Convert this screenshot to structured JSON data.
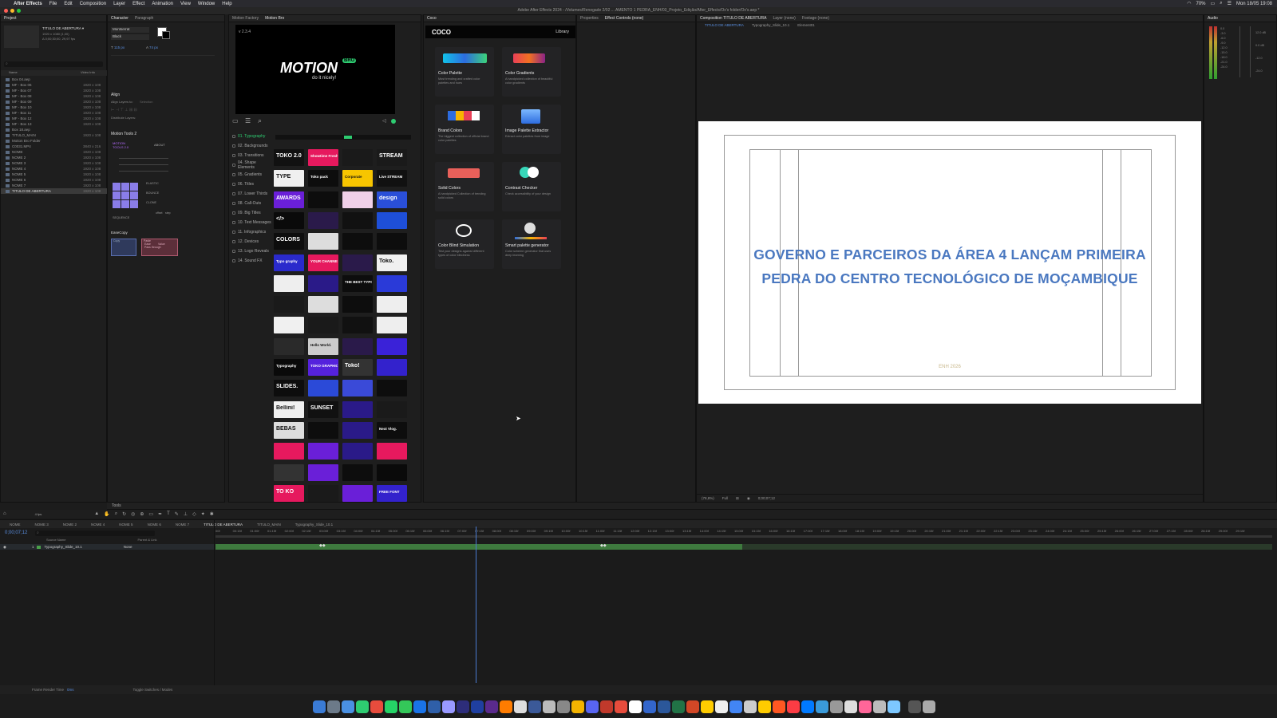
{
  "menubar": {
    "apple": "",
    "app": "After Effects",
    "items": [
      "File",
      "Edit",
      "Composition",
      "Layer",
      "Effect",
      "Animation",
      "View",
      "Window",
      "Help"
    ],
    "battery": "70%",
    "clock": "Mon 18/05  19:08"
  },
  "window_title": "Adobe After Effects 2024 - /Volumes/Renegade 2/02 ... AMENTO 1 PEDRA_ENH/03_Projeto_Edição/After_Effects/Ox's folder/Ox's.aep *",
  "project": {
    "tab": "Project",
    "comp_name": "TITULO DE ABERTURA ▾",
    "comp_info": [
      "1920 x 1080 (1,00)",
      "Δ 0;00;30;00, 29,97 fps"
    ],
    "col_name": "Name",
    "col_video": "Video Info",
    "items": [
      {
        "name": "Box 04.aep",
        "info": ""
      },
      {
        "name": "MF - Box 06",
        "info": "1920 x 108"
      },
      {
        "name": "MF - Box 07",
        "info": "1920 x 108"
      },
      {
        "name": "MF - Box 08",
        "info": "1920 x 108"
      },
      {
        "name": "MF - Box 09",
        "info": "1920 x 108"
      },
      {
        "name": "MF - Box 10",
        "info": "1920 x 108"
      },
      {
        "name": "MF - Box 11",
        "info": "1920 x 108"
      },
      {
        "name": "MF - Box 12",
        "info": "1920 x 108"
      },
      {
        "name": "MF - Box 13",
        "info": "1920 x 108"
      },
      {
        "name": "Box 18.aep",
        "info": ""
      },
      {
        "name": "TITULO_MAIN",
        "info": "1920 x 108"
      },
      {
        "name": "Motion Bro Folder",
        "info": ""
      },
      {
        "name": "C0031.MP4",
        "info": "3840 x 216"
      },
      {
        "name": "NOME",
        "info": "1920 x 108"
      },
      {
        "name": "NOME 2",
        "info": "1920 x 108"
      },
      {
        "name": "NOME 3",
        "info": "1920 x 108"
      },
      {
        "name": "NOME 4",
        "info": "1920 x 108"
      },
      {
        "name": "NOME 5",
        "info": "1920 x 108"
      },
      {
        "name": "NOME 6",
        "info": "1920 x 108"
      },
      {
        "name": "NOME 7",
        "info": "1920 x 108"
      },
      {
        "name": "TITULO DE ABERTURA",
        "info": "1920 x 108"
      }
    ]
  },
  "character": {
    "tabs": [
      "Character",
      "Paragraph"
    ],
    "font": "Montserrat",
    "style": "Black",
    "size": "115 px",
    "leading": "74 px",
    "align_title": "Align",
    "align_to": "Align Layers to:",
    "align_sel": "Selection",
    "distribute": "Distribute Layers:"
  },
  "motion_tools": {
    "title": "Motion Tools 2",
    "logo": "MOTION TOOLS 2.0",
    "about": "ABOUT",
    "labels": [
      "ELASTIC",
      "BOUNCE",
      "CLONE",
      "SEQUENCE",
      "offset",
      "step"
    ]
  },
  "easecopy": {
    "title": "EaseCopy",
    "copy": "Copy",
    "paste": "Paste",
    "ease": "Ease",
    "value": "Value",
    "pass": "Pass through"
  },
  "motion_bro": {
    "tabs": [
      "Motion Factory",
      "Motion Bro"
    ],
    "version": "v 2.3.4",
    "logo": "MOTION",
    "logo_badge": "BRO",
    "tagline": "do it nicely!",
    "categories": [
      "01. Typography",
      "02. Backgrounds",
      "03. Transitions",
      "04. Shape Elements",
      "05. Gradients",
      "06. Titles",
      "07. Lower Thirds",
      "08. Call-Outs",
      "09. Big Titles",
      "10. Text Messages",
      "11. Infographics",
      "12. Devices",
      "13. Logo Reveals",
      "14. Sound FX"
    ],
    "thumbs_text": [
      "TOKO 2.0",
      "Showtime Fresh",
      "",
      "STREAM",
      "TYPE",
      "Toko pack",
      "Corporate",
      "Live STREAM",
      "AWARDS",
      "",
      "",
      "design",
      "</>",
      "",
      "",
      "",
      "COLORS",
      "",
      "",
      "",
      "Typo graphy",
      "YOUR CHANNEL",
      "",
      "Toko.",
      "",
      "",
      "THE BEST TYPOGRAPHY",
      "",
      "",
      "",
      "",
      "",
      "",
      "",
      "",
      "",
      "",
      "Hello World.",
      "",
      "",
      "Typography",
      "TOKO GRAPHICS",
      "Toko!",
      "",
      "SLIDES.",
      "",
      "",
      "",
      "Bellini!",
      "SUNSET",
      "",
      "",
      "BEBAS",
      "",
      "",
      "Next Vlog.",
      "",
      "",
      "",
      "",
      "",
      "",
      "",
      "",
      "TO KO",
      "",
      "",
      "FREE FONT"
    ]
  },
  "coco": {
    "tab": "Coco",
    "logo": "COCO",
    "library": "Library",
    "cards": [
      {
        "title": "Color Palette",
        "desc": "Most trending and crafted color palettes and hues"
      },
      {
        "title": "Color Gradients",
        "desc": "A handpicked collection of beautiful color gradients"
      },
      {
        "title": "Brand Colors",
        "desc": "The biggest collection of official brand color palettes"
      },
      {
        "title": "Image Palette Extractor",
        "desc": "Extract color palettes from image"
      },
      {
        "title": "Solid Colors",
        "desc": "A handpicked Collection of trending solid colors"
      },
      {
        "title": "Contrast Checker",
        "desc": "Check accessibility of your design"
      },
      {
        "title": "Color Blind Simulation",
        "desc": "Test your designs against different types of color blindness"
      },
      {
        "title": "Smart palette generator",
        "desc": "Color scheme generator that uses deep learning"
      }
    ]
  },
  "effect_controls": {
    "tabs": [
      "Properties",
      "Effect Controls (none)"
    ]
  },
  "composition": {
    "tabs": [
      "Composition TITULO DE ABERTURA",
      "Layer (none)",
      "Footage (none)"
    ],
    "crumbs": [
      "TITULO DE ABERTURA",
      "Typography_Slide_10.1",
      "Element01"
    ],
    "title_line1": "GOVERNO E PARCEIROS DA ÁREA 4 LANÇAM PRIMEIRA",
    "title_line2": "PEDRA DO CENTRO TECNOLÓGICO DE MOÇAMBIQUE",
    "footer_text": "ENH 2026",
    "zoom": "(78,8%)",
    "quality": "Full",
    "timecode": "0;00;07;12",
    "accent": "#4a78c0"
  },
  "audio": {
    "tab": "Audio",
    "levels": [
      "0.0",
      "-3.0",
      "-6.0",
      "-9.0",
      "-12.0",
      "-15.0",
      "-18.0",
      "-21.0",
      "-24.0"
    ],
    "db_right": [
      "12.0 dB",
      "0.0 dB",
      "-12.0",
      "-24.0"
    ]
  },
  "tools": {
    "tab": "Tools",
    "fps": "4 fps"
  },
  "timeline": {
    "tabs": [
      "NOME",
      "NOME 3",
      "NOME 2",
      "NOME 4",
      "NOME 5",
      "NOME 6",
      "NOME 7",
      "TITULO DE ABERTURA",
      "TITULO_MAIN",
      "Typography_Slide_10.1"
    ],
    "timecode": "0;00;07;12",
    "col_source": "Source Name",
    "col_parent": "Parent & Link",
    "layer_num": "1",
    "layer_name": "Typography_Slide_10.1",
    "parent": "None",
    "ticks": [
      "00f",
      "00:15f",
      "01:00f",
      "01:15f",
      "02:00f",
      "02:15f",
      "03:00f",
      "03:15f",
      "04:00f",
      "04:15f",
      "05:00f",
      "05:15f",
      "06:00f",
      "06:15f",
      "07:00f",
      "07:15f",
      "08:00f",
      "08:15f",
      "09:00f",
      "09:15f",
      "10:00f",
      "10:15f",
      "11:00f",
      "11:15f",
      "12:00f",
      "12:15f",
      "13:00f",
      "13:15f",
      "14:00f",
      "14:15f",
      "15:00f",
      "15:15f",
      "16:00f",
      "16:15f",
      "17:00f",
      "17:15f",
      "18:00f",
      "18:15f",
      "19:00f",
      "19:15f",
      "20:00f",
      "20:15f",
      "21:00f",
      "21:15f",
      "22:00f",
      "22:15f",
      "23:00f",
      "23:15f",
      "24:00f",
      "24:15f",
      "25:00f",
      "25:15f",
      "26:00f",
      "26:15f",
      "27:00f",
      "27:15f",
      "28:00f",
      "28:15f",
      "29:00f",
      "29:15f"
    ],
    "status_left": "Frame Render Time",
    "status_time": "0ms",
    "status_mid": "Toggle Switches / Modes"
  },
  "dock_colors": [
    "#3a7bd5",
    "#6c7a89",
    "#4a90e2",
    "#2ecc71",
    "#e84c3d",
    "#25d366",
    "#34c759",
    "#1a73e8",
    "#2f5fa8",
    "#9999ff",
    "#2d2d7a",
    "#1f3fa0",
    "#5a2a8c",
    "#ff7c00",
    "#dddddd",
    "#3b5998",
    "#bbbbbb",
    "#888888",
    "#f4b400",
    "#5865f2",
    "#c0392b",
    "#e74c3c",
    "#ffffff",
    "#3366cc",
    "#2b579a",
    "#217346",
    "#d24726",
    "#ffcc00",
    "#eeeeee",
    "#4285f4",
    "#cccccc",
    "#ffcc00",
    "#ff5722",
    "#fc3c44",
    "#007aff",
    "#3a9ad9",
    "#999999",
    "#dddddd",
    "#ff6699",
    "#bbbbbb",
    "#7dc8ff",
    "#555555",
    "#aaaaaa"
  ]
}
